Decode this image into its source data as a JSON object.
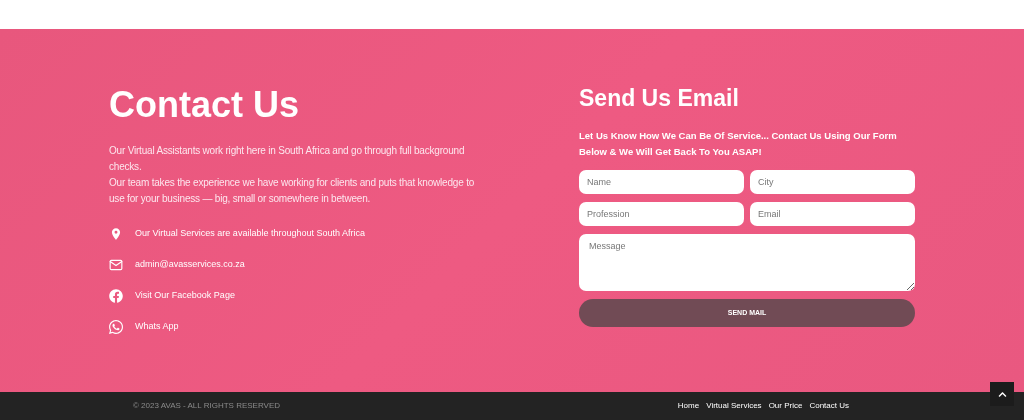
{
  "contact": {
    "title": "Contact Us",
    "paragraphs": [
      "Our Virtual Assistants work right here in South Africa and go through full background checks.",
      "Our team takes the experience we have working for clients and puts that knowledge to use for your business — big, small or somewhere in between."
    ],
    "items": [
      {
        "kind": "location",
        "text": "Our Virtual Services are available throughout South Africa"
      },
      {
        "kind": "email",
        "text": "admin@avasservices.co.za"
      },
      {
        "kind": "facebook",
        "text": "Visit Our Facebook Page"
      },
      {
        "kind": "whatsapp",
        "text": "Whats App"
      }
    ]
  },
  "form": {
    "title": "Send Us Email",
    "intro": "Let Us Know How We Can Be Of Service... Contact Us Using Our Form Below & We Will Get Back To You ASAP!",
    "fields": [
      {
        "placeholder": "Name"
      },
      {
        "placeholder": "City"
      },
      {
        "placeholder": "Profession"
      },
      {
        "placeholder": "Email"
      }
    ],
    "message": {
      "placeholder": "Message"
    },
    "button": "SEND MAIL"
  },
  "footer": {
    "copyright": "© 2023 AVAS - ALL RIGHTS RESERVED",
    "links": [
      "Home",
      "Virtual Services",
      "Our Price",
      "Contact Us"
    ]
  }
}
